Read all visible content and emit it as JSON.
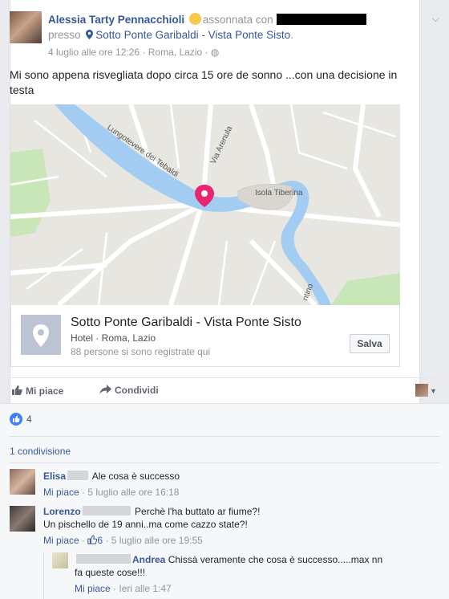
{
  "post": {
    "author": "Alessia Tarty Pennacchioli",
    "feeling": "assonnata con",
    "place_prefix": "presso",
    "place_name": "Sotto Ponte Garibaldi - Vista Ponte Sisto",
    "place_suffix": ".",
    "date": "4 luglio alle ore 12:26",
    "location": "Roma, Lazio",
    "text": "Mi sono appena risvegliata dopo circa 15 ore de sonno ...con una decisione in testa"
  },
  "map": {
    "labels": [
      "Lungotevere dei Tebaldi",
      "Via Arenula",
      "Isola Tiberina",
      "ntino"
    ]
  },
  "place_card": {
    "title": "Sotto Ponte Garibaldi - Vista Ponte Sisto",
    "category": "Hotel · Roma, Lazio",
    "checkins": "88 persone si sono registrate qui",
    "save_label": "Salva"
  },
  "actions": {
    "like": "Mi piace",
    "share": "Condividi"
  },
  "reactions": {
    "count": "4"
  },
  "shares": {
    "label": "1 condivisione"
  },
  "comments": [
    {
      "name": "Elisa",
      "text": "Ale cosa è successo",
      "like": "Mi piace",
      "time": "5 luglio alle ore 16:18"
    },
    {
      "name": "Lorenzo",
      "text": "Perchè l'ha buttato ar fiume?!",
      "text2": "Un pischello de 19 anni..ma come cazzo state?!",
      "like": "Mi piace",
      "likes": "6",
      "time": "5 luglio alle ore 19:55"
    },
    {
      "name": "Andrea",
      "text": "Chissà veramente che cosa è successo.....max nn",
      "text2": "fa queste cose!!!",
      "like": "Mi piace",
      "time": "Ieri alle 1:47"
    }
  ],
  "colors": {
    "link": "#365899",
    "like_blue": "#4080ff",
    "river": "#a3ccf2",
    "pin": "#e8256e"
  }
}
